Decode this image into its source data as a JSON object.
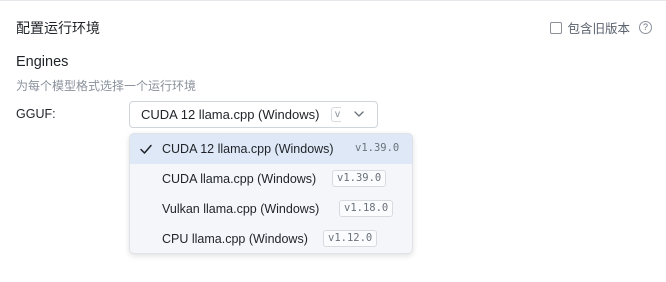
{
  "header": {
    "title": "配置运行环境",
    "include_old_label": "包含旧版本",
    "help_icon_glyph": "?"
  },
  "engines": {
    "title": "Engines",
    "subtitle": "为每个模型格式选择一个运行环境",
    "gguf_label": "GGUF:",
    "selected_value": "CUDA 12 llama.cpp (Windows)",
    "selected_version_peek": "v",
    "options": [
      {
        "name": "CUDA 12 llama.cpp (Windows)",
        "version": "v1.39.0",
        "selected": true
      },
      {
        "name": "CUDA llama.cpp (Windows)",
        "version": "v1.39.0",
        "selected": false
      },
      {
        "name": "Vulkan llama.cpp (Windows)",
        "version": "v1.18.0",
        "selected": false
      },
      {
        "name": "CPU llama.cpp (Windows)",
        "version": "v1.12.0",
        "selected": false
      }
    ]
  },
  "icons": {
    "checkbox": "checkbox-icon",
    "help": "help-circle-icon",
    "chevron": "chevron-down-icon",
    "check": "checkmark-icon"
  },
  "colors": {
    "selected_option_bg": "#dfe8f6",
    "dropdown_bg": "#f4f6f9"
  }
}
